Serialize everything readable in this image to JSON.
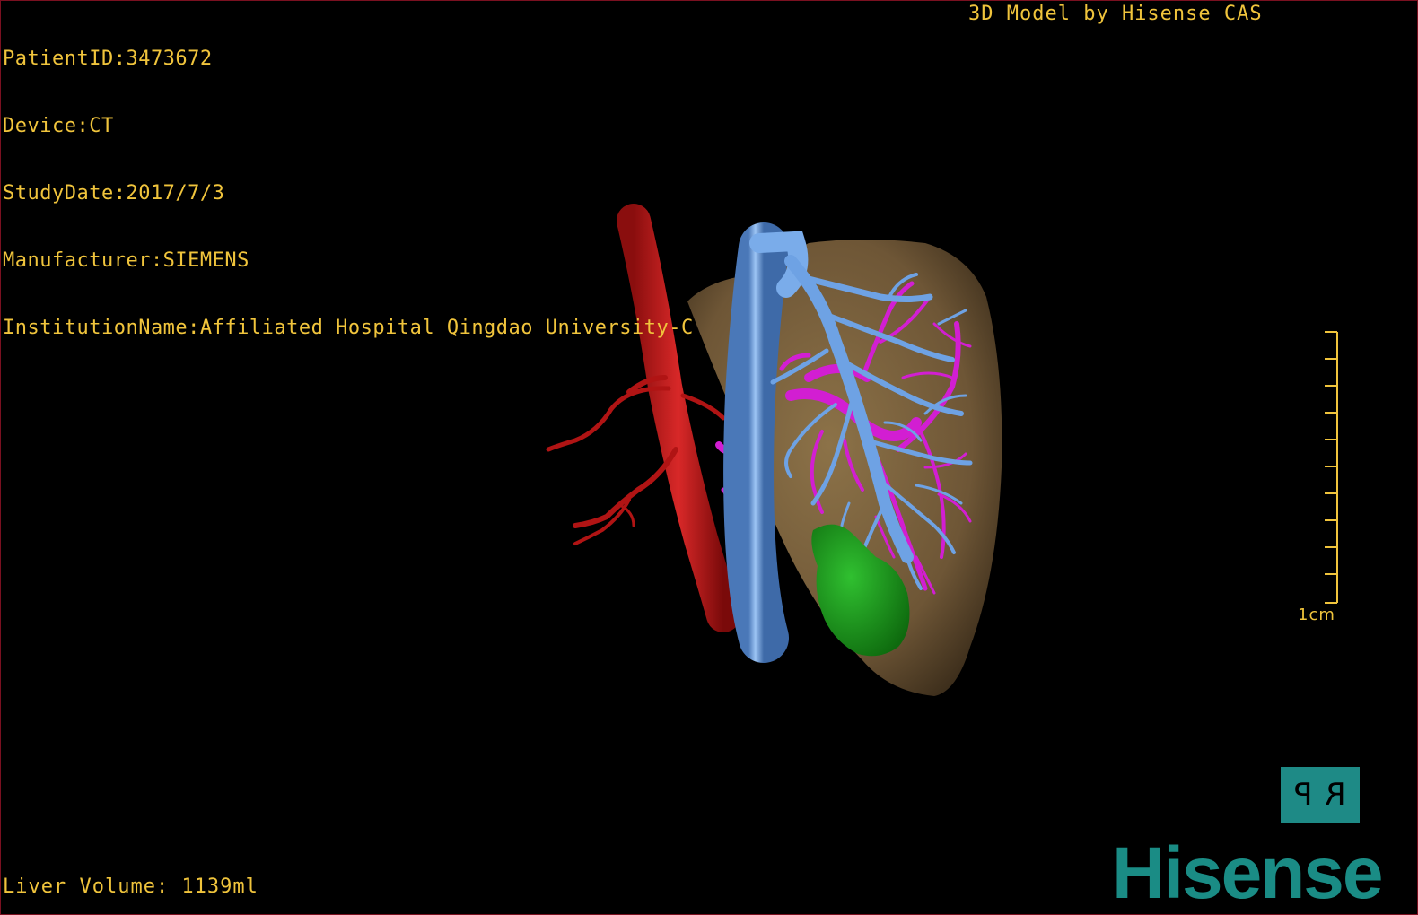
{
  "overlay": {
    "patient_id": "PatientID:3473672",
    "device": "Device:CT",
    "study_date": "StudyDate:2017/7/3",
    "manufacturer": "Manufacturer:SIEMENS",
    "institution": "InstitutionName:Affiliated Hospital Qingdao University-C",
    "credit": "3D Model by Hisense CAS",
    "liver_volume": "Liver Volume: 1139ml"
  },
  "scale_bar": {
    "label": "1cm"
  },
  "orientation_cube": {
    "left_face": "P",
    "right_face": "R"
  },
  "brand": {
    "logo_text": "Hisense"
  },
  "colors": {
    "overlay_text": "#f0c43c",
    "liver": "#7a6240",
    "hepatic_artery": "#c01818",
    "vena_cava_hepatic_veins": "#6aa0e0",
    "portal_vein": "#d020d0",
    "tumor": "#18a018",
    "brand": "#1a8c85",
    "frame_border": "#7a1020"
  },
  "icons": [
    "orientation-cube-icon",
    "scale-bar-icon",
    "hisense-logo"
  ]
}
